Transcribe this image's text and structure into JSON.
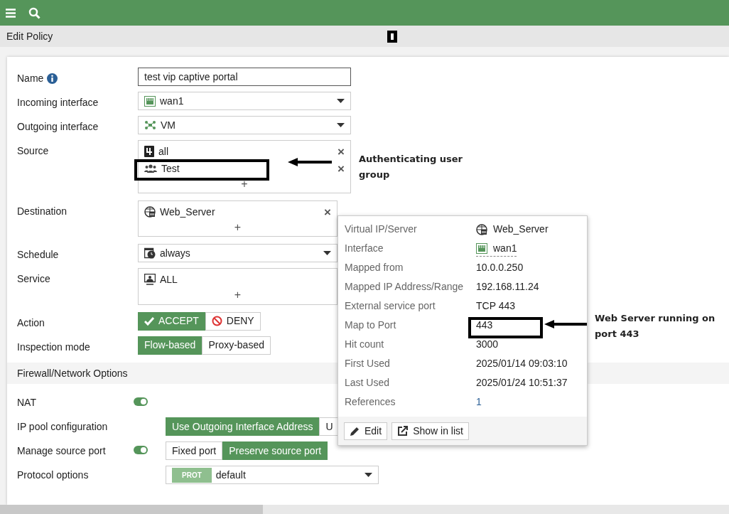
{
  "title": "Edit Policy",
  "policy_fields": [
    {
      "kind": "text",
      "label": "Name",
      "value": "test vip captive portal"
    },
    {
      "kind": "select",
      "label": "Incoming interface",
      "value": "wan1"
    },
    {
      "kind": "select",
      "label": "Outgoing interface",
      "value": "VM"
    },
    {
      "kind": "multi",
      "label": "Source",
      "entries": [
        {
          "text": "all",
          "remove": "×"
        },
        {
          "text": "Test",
          "remove": "×"
        }
      ],
      "add": "+"
    },
    {
      "kind": "multi",
      "label": "Destination",
      "entries": [
        {
          "text": "Web_Server",
          "remove": "×"
        }
      ],
      "add": "+"
    },
    {
      "kind": "select",
      "label": "Schedule",
      "value": "always"
    },
    {
      "kind": "multi",
      "label": "Service",
      "entries": [
        {
          "text": "ALL"
        }
      ],
      "add": "+"
    },
    {
      "kind": "segmented",
      "label": "Action",
      "options": [
        {
          "text": "ACCEPT",
          "selected": true
        },
        {
          "text": "DENY",
          "selected": false
        }
      ]
    },
    {
      "kind": "segmented",
      "label": "Inspection mode",
      "options": [
        {
          "text": "Flow-based",
          "selected": true
        },
        {
          "text": "Proxy-based",
          "selected": false
        }
      ]
    }
  ],
  "section_title": "Firewall/Network Options",
  "nat_fields": [
    {
      "kind": "toggle",
      "label": "NAT",
      "on": true
    },
    {
      "kind": "segmented",
      "label": "IP pool configuration",
      "options": [
        {
          "text": "Use Outgoing Interface Address",
          "selected": true
        },
        {
          "text": "U",
          "selected": false
        }
      ]
    },
    {
      "kind": "toggle-segmented",
      "label": "Manage source port",
      "on": true,
      "options": [
        {
          "text": "Fixed port",
          "selected": false
        },
        {
          "text": "Preserve source port",
          "selected": true
        }
      ]
    },
    {
      "kind": "select",
      "label": "Protocol options",
      "badge": "PROT",
      "value": "default"
    }
  ],
  "popover": {
    "rows": [
      {
        "label": "Virtual IP/Server",
        "value": "Web_Server",
        "kind": "plain"
      },
      {
        "label": "Interface",
        "value": "wan1",
        "kind": "underlined"
      },
      {
        "label": "Mapped from",
        "value": "10.0.0.250",
        "kind": "plain"
      },
      {
        "label": "Mapped IP Address/Range",
        "value": "192.168.11.24",
        "kind": "plain"
      },
      {
        "label": "External service port",
        "value": "TCP 443",
        "kind": "plain"
      },
      {
        "label": "Map to Port",
        "value": "443",
        "kind": "plain"
      },
      {
        "label": "Hit count",
        "value": "3000",
        "kind": "plain"
      },
      {
        "label": "First Used",
        "value": "2025/01/14 09:03:10",
        "kind": "plain"
      },
      {
        "label": "Last Used",
        "value": "2025/01/24 10:51:37",
        "kind": "plain"
      },
      {
        "label": "References",
        "value": "1",
        "kind": "link"
      }
    ],
    "buttons": [
      {
        "text": "Edit"
      },
      {
        "text": "Show in list"
      }
    ]
  },
  "annotations": [
    {
      "text": "Authenticating user group"
    },
    {
      "text": "Web Server running on port 443"
    }
  ]
}
